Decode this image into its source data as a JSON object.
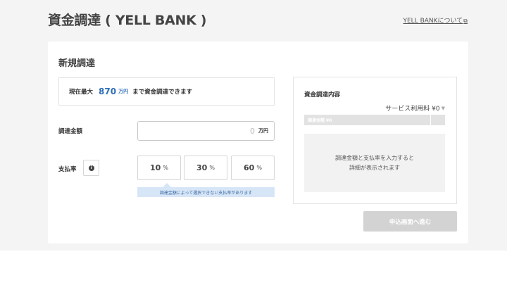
{
  "header": {
    "title": "資金調達 ( YELL BANK )",
    "about_link": "YELL BANKについて"
  },
  "form": {
    "section_title": "新規調達",
    "limit": {
      "prefix": "現在最大",
      "amount": "870",
      "unit": "万円",
      "suffix": "まで資金調達できます"
    },
    "amount_field": {
      "label": "調達金額",
      "value": "0",
      "unit": "万円"
    },
    "rate_field": {
      "label": "支払率",
      "info_icon_glyph": "i",
      "options": [
        {
          "value": "10",
          "unit": "%"
        },
        {
          "value": "30",
          "unit": "%"
        },
        {
          "value": "60",
          "unit": "%"
        }
      ],
      "hint": "調達金額によって選択できない支払率があります"
    }
  },
  "summary": {
    "title": "資金調達内容",
    "fee": "サービス利用料 ¥0",
    "bar_label": "調達金額 ¥0",
    "message_line1": "調達金額と支払率を入力すると",
    "message_line2": "詳細が表示されます"
  },
  "submit_label": "申込画面へ進む",
  "icons": {
    "external": "external-link-icon",
    "info": "info-icon",
    "chevron": "chevron-down-icon"
  },
  "colors": {
    "accent": "#2f6fb7",
    "hint_bg": "#d7e6f7",
    "disabled_button": "#d3d3d3"
  }
}
